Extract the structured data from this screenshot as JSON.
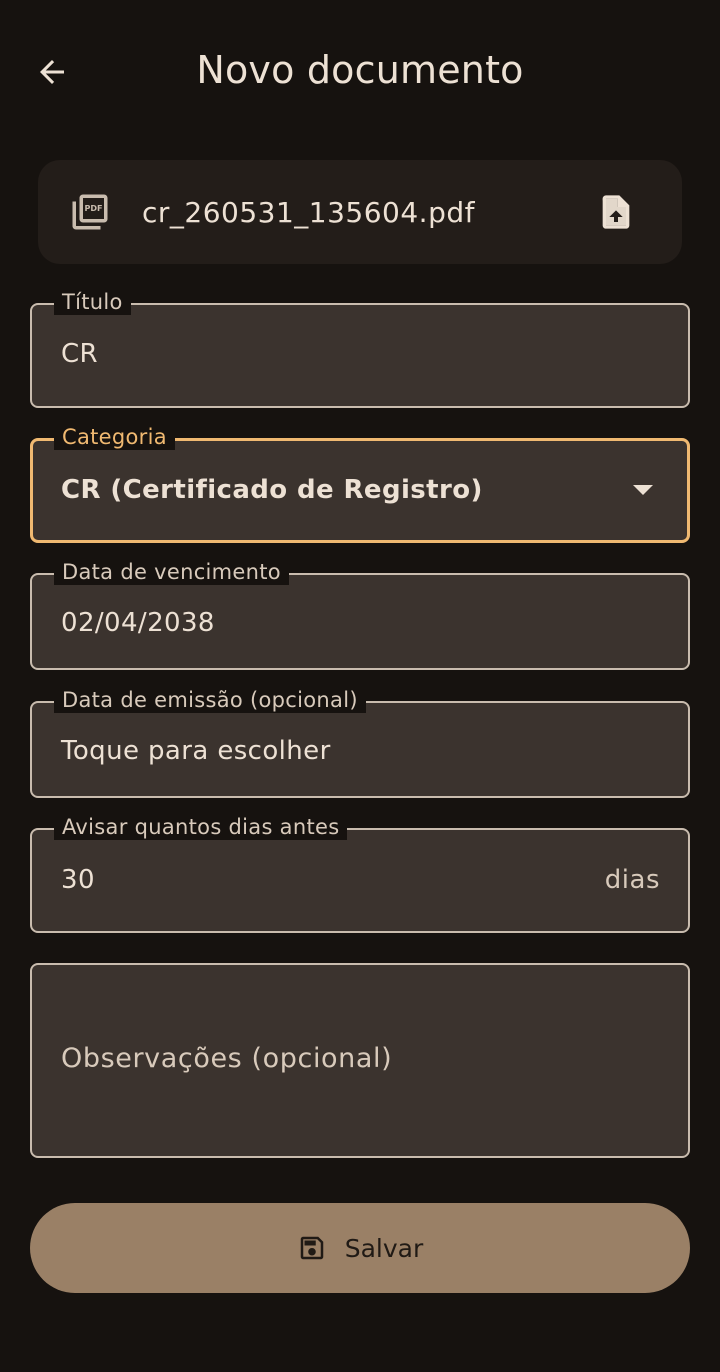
{
  "header": {
    "title": "Novo documento",
    "back_icon": "arrow-left-icon"
  },
  "file": {
    "name": "cr_260531_135604.pdf",
    "file_icon": "pdf-icon",
    "upload_icon": "file-upload-icon"
  },
  "form": {
    "titulo": {
      "label": "Título",
      "value": "CR"
    },
    "categoria": {
      "label": "Categoria",
      "value": "CR (Certificado de Registro)"
    },
    "vencimento": {
      "label": "Data de vencimento",
      "value": "02/04/2038"
    },
    "emissao": {
      "label": "Data de emissão (opcional)",
      "value": "Toque para escolher"
    },
    "aviso": {
      "label": "Avisar quantos dias antes",
      "value": "30",
      "suffix": "dias"
    },
    "observacoes": {
      "placeholder": "Observações (opcional)"
    }
  },
  "actions": {
    "save_label": "Salvar",
    "save_icon": "save-icon"
  },
  "colors": {
    "background": "#16120f",
    "field_fill": "#3b332e",
    "accent": "#f0b971",
    "button": "#9a8066"
  }
}
